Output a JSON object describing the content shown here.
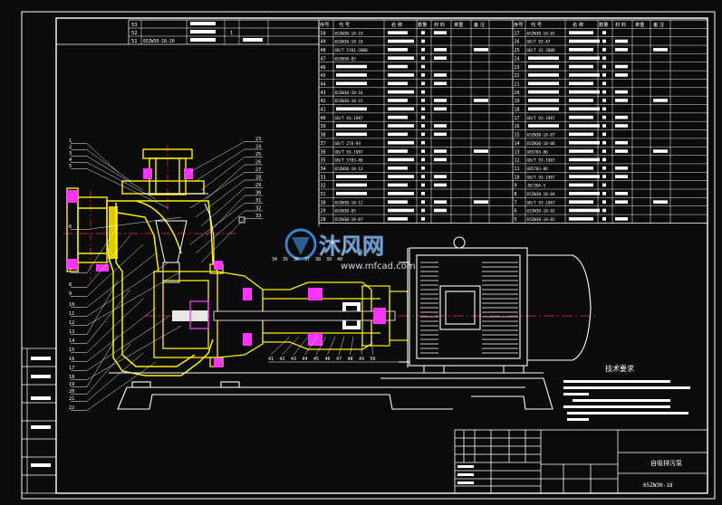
{
  "top_left_table": {
    "rows": [
      {
        "no": "53",
        "code": ""
      },
      {
        "no": "52",
        "code": ""
      },
      {
        "no": "51",
        "code": "65ZW30-18-20"
      }
    ]
  },
  "parts_header": {
    "left": [
      "序号",
      "代  号",
      "名  称",
      "数量",
      "材 料",
      "单重",
      "备 注"
    ],
    "right": [
      "序号",
      "代  号",
      "名  称",
      "数量",
      "材 料",
      "单重",
      "备 注"
    ]
  },
  "parts_left": [
    {
      "no": "50",
      "code": "65ZW30-18-19"
    },
    {
      "no": "49",
      "code": "65ZW30-18-18"
    },
    {
      "no": "48",
      "code": "GB/T 5781-2000"
    },
    {
      "no": "47",
      "code": "65ZW30-05"
    },
    {
      "no": "46",
      "code": ""
    },
    {
      "no": "45",
      "code": ""
    },
    {
      "no": "44",
      "code": ""
    },
    {
      "no": "43",
      "code": "65ZW30-18-16"
    },
    {
      "no": "42",
      "code": "65ZW30-18-15"
    },
    {
      "no": "41",
      "code": ""
    },
    {
      "no": "40",
      "code": "GB/T 93-1987"
    },
    {
      "no": "39",
      "code": ""
    },
    {
      "no": "38",
      "code": ""
    },
    {
      "no": "37",
      "code": "GB/T 276-94"
    },
    {
      "no": "36",
      "code": "GB/T 93-1987"
    },
    {
      "no": "35",
      "code": "GB/T 5783-86"
    },
    {
      "no": "34",
      "code": "65ZW30-18-13"
    },
    {
      "no": "33",
      "code": ""
    },
    {
      "no": "32",
      "code": ""
    },
    {
      "no": "31",
      "code": ""
    },
    {
      "no": "30",
      "code": "65ZW30-18-12"
    },
    {
      "no": "29",
      "code": "65ZW30-05"
    },
    {
      "no": "28",
      "code": "65ZW30-18-07"
    }
  ],
  "parts_right": [
    {
      "no": "27",
      "code": "65ZW30-18-01"
    },
    {
      "no": "26",
      "code": "GB/T 93-87"
    },
    {
      "no": "25",
      "code": "GB/T 41-2000"
    },
    {
      "no": "24",
      "code": ""
    },
    {
      "no": "23",
      "code": ""
    },
    {
      "no": "22",
      "code": ""
    },
    {
      "no": "21",
      "code": ""
    },
    {
      "no": "20",
      "code": ""
    },
    {
      "no": "19",
      "code": ""
    },
    {
      "no": "18",
      "code": ""
    },
    {
      "no": "17",
      "code": "GB/T 93-1987"
    },
    {
      "no": "16",
      "code": ""
    },
    {
      "no": "15",
      "code": "65ZW30-18-07"
    },
    {
      "no": "14",
      "code": "65ZW30-18-06"
    },
    {
      "no": "13",
      "code": "GB5783-86"
    },
    {
      "no": "12",
      "code": "GB/T 93-1987"
    },
    {
      "no": "11",
      "code": "GB5783-86"
    },
    {
      "no": "10",
      "code": "GB/T 93-1987"
    },
    {
      "no": "9",
      "code": "JB/ZQ4-5"
    },
    {
      "no": "8",
      "code": "65ZW30-18-04"
    },
    {
      "no": "7",
      "code": "GB/T 93-1987"
    },
    {
      "no": "6",
      "code": "65ZW30-18-03"
    },
    {
      "no": "5",
      "code": "65ZW30-18-02"
    }
  ],
  "watermark": {
    "brand": "沐风网",
    "url": "www.mfcad.com"
  },
  "tech_requirements": {
    "title": "技术要求"
  },
  "title_block": {
    "name": "自吸排污泵",
    "code": "65ZW30-18"
  },
  "left_callouts": [
    "1",
    "2",
    "3",
    "4",
    "5",
    "6",
    "7",
    "8",
    "9",
    "10",
    "11",
    "12",
    "13",
    "14",
    "15",
    "16",
    "17",
    "18",
    "19",
    "20",
    "21",
    "22"
  ],
  "right_callouts": [
    "23",
    "24",
    "25",
    "26",
    "27",
    "28",
    "29",
    "30",
    "31",
    "32",
    "33"
  ],
  "bottom_callouts": [
    "41",
    "42",
    "43",
    "44",
    "45",
    "46",
    "47",
    "48",
    "49",
    "50"
  ],
  "colors": {
    "background": "#0b0b0b",
    "lines": "#ffffff",
    "red": "#ff2a2a",
    "yellow": "#ffef00",
    "magenta": "#ff33ff"
  }
}
